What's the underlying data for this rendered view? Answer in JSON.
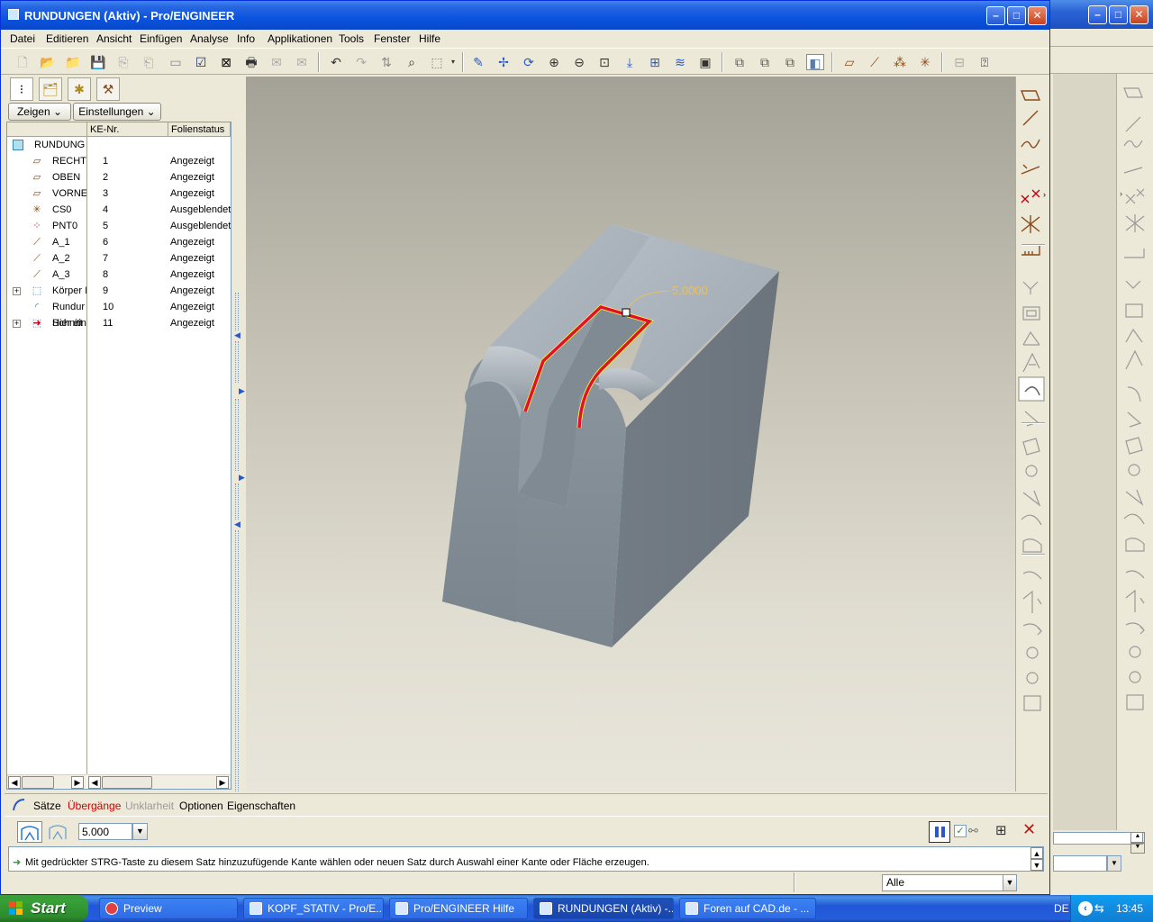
{
  "window": {
    "title": "RUNDUNGEN (Aktiv) - Pro/ENGINEER"
  },
  "menubar": {
    "items": [
      {
        "label": "Datei"
      },
      {
        "label": "Editieren"
      },
      {
        "label": "Ansicht"
      },
      {
        "label": "Einfügen"
      },
      {
        "label": "Analyse"
      },
      {
        "label": "Info"
      },
      {
        "label": "Applikationen"
      },
      {
        "label": "Tools"
      },
      {
        "label": "Fenster"
      },
      {
        "label": "Hilfe"
      }
    ]
  },
  "leftpanel": {
    "show_label": "Zeigen",
    "settings_label": "Einstellungen",
    "col_ke_nr": "KE-Nr.",
    "col_status": "Folienstatus",
    "root": "RUNDUNG",
    "rows": [
      {
        "name": "RECHT",
        "nr": "1",
        "status": "Angezeigt",
        "icon": "datum-plane-icon"
      },
      {
        "name": "OBEN",
        "nr": "2",
        "status": "Angezeigt",
        "icon": "datum-plane-icon"
      },
      {
        "name": "VORNE",
        "nr": "3",
        "status": "Angezeigt",
        "icon": "datum-plane-icon"
      },
      {
        "name": "CS0",
        "nr": "4",
        "status": "Ausgeblendet",
        "icon": "coordinate-system-icon"
      },
      {
        "name": "PNT0",
        "nr": "5",
        "status": "Ausgeblendet",
        "icon": "datum-point-icon"
      },
      {
        "name": "A_1",
        "nr": "6",
        "status": "Angezeigt",
        "icon": "datum-axis-icon"
      },
      {
        "name": "A_2",
        "nr": "7",
        "status": "Angezeigt",
        "icon": "datum-axis-icon"
      },
      {
        "name": "A_3",
        "nr": "8",
        "status": "Angezeigt",
        "icon": "datum-axis-icon"
      },
      {
        "name": "Körper I",
        "nr": "9",
        "status": "Angezeigt",
        "icon": "extrude-icon"
      },
      {
        "name": "Rundur",
        "nr": "10",
        "status": "Angezeigt",
        "icon": "round-icon"
      },
      {
        "name": "Schnitt",
        "nr": "11",
        "status": "Angezeigt",
        "icon": "cut-icon"
      }
    ],
    "insert_here": "Hier ein"
  },
  "graphics": {
    "dimension_label": "5.0000"
  },
  "dashboard": {
    "tabs": [
      {
        "label": "Sätze",
        "color": "#000000"
      },
      {
        "label": "Übergänge",
        "color": "#cc0000"
      },
      {
        "label": "Unklarheit",
        "color": "#9a9a9a"
      },
      {
        "label": "Optionen",
        "color": "#000000"
      },
      {
        "label": "Eigenschaften",
        "color": "#000000"
      }
    ],
    "radius_value": "5.000"
  },
  "message": {
    "text": "Mit gedrückter STRG-Taste zu diesem Satz hinzuzufügende Kante wählen oder neuen Satz durch Auswahl einer Kante oder Fläche erzeugen."
  },
  "statusbar": {
    "filter_value": "Alle"
  },
  "taskbar": {
    "start_label": "Start",
    "tasks": [
      {
        "label": "Preview"
      },
      {
        "label": "KOPF_STATIV - Pro/E..."
      },
      {
        "label": "Pro/ENGINEER Hilfe"
      },
      {
        "label": "RUNDUNGEN (Aktiv) -..."
      },
      {
        "label": "Foren auf CAD.de - ..."
      }
    ],
    "language": "DE",
    "clock": "13:45"
  },
  "colors": {
    "selection_edge": "#e01030",
    "highlight_edge": "#ffff40",
    "model_top": "#a9b2ba",
    "model_front": "#7d8790"
  }
}
